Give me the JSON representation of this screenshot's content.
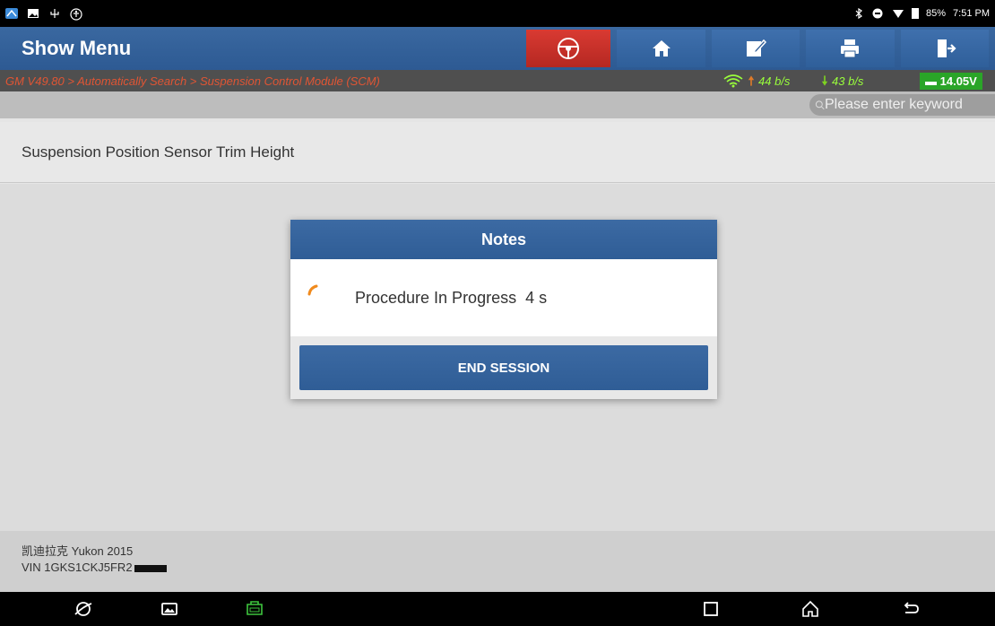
{
  "status_bar": {
    "battery": "85%",
    "time": "7:51 PM"
  },
  "header": {
    "title": "Show Menu",
    "buttons": [
      {
        "name": "steering-wheel",
        "icon": "steering-wheel-icon"
      },
      {
        "name": "home",
        "icon": "home-icon"
      },
      {
        "name": "edit",
        "icon": "edit-icon"
      },
      {
        "name": "print",
        "icon": "print-icon"
      },
      {
        "name": "exit",
        "icon": "exit-icon"
      }
    ],
    "accent_red": "#c8302a",
    "accent_blue": "#2f5d96"
  },
  "breadcrumb": {
    "path": "GM V49.80 > Automatically Search > Suspension Control Module (SCM)",
    "upload_speed": "44 b/s",
    "download_speed": "43 b/s",
    "voltage": "14.05V"
  },
  "search": {
    "placeholder": "Please enter keyword"
  },
  "function": {
    "label": "Suspension Position Sensor Trim Height"
  },
  "dialog": {
    "title": "Notes",
    "message": "Procedure In Progress  4 s",
    "button_label": "END SESSION"
  },
  "vehicle": {
    "model": "凯迪拉克 Yukon 2015",
    "vin": "VIN 1GKS1CKJ5FR2"
  }
}
